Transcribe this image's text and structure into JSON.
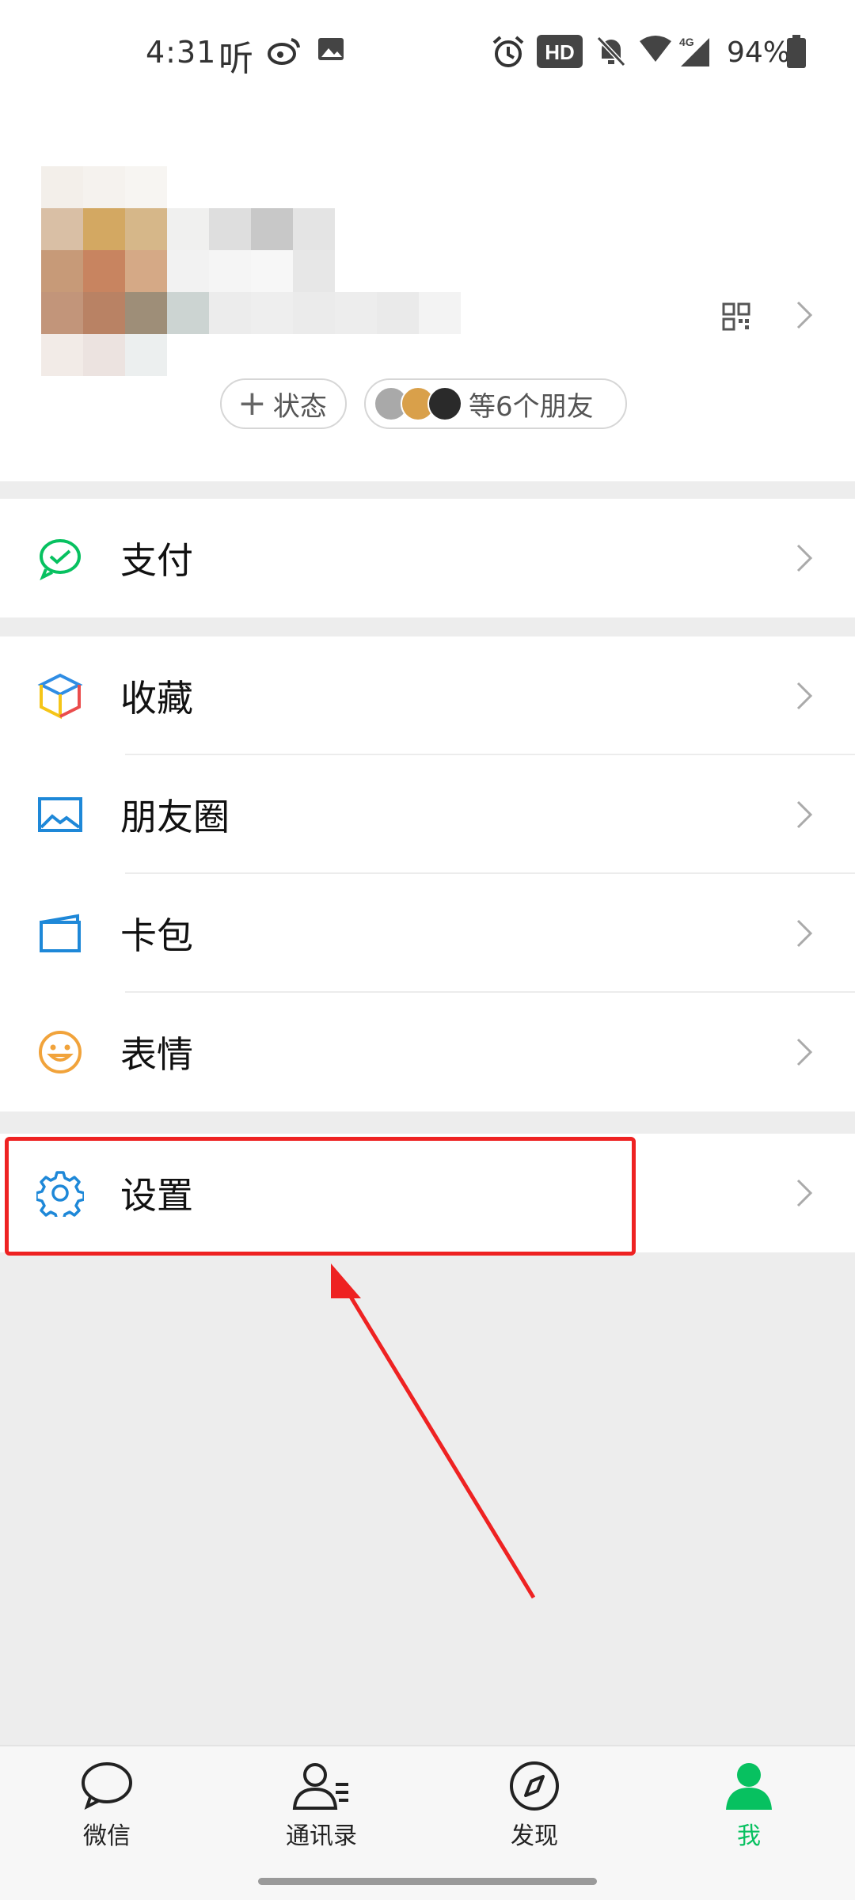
{
  "status_bar": {
    "time": "4:31",
    "listen_glyph": "听",
    "battery_percent": "94%",
    "network": "4G",
    "hd_badge": "HD",
    "icons": [
      "weibo-icon",
      "gallery-icon",
      "alarm-icon",
      "hd-icon",
      "mute-icon",
      "wifi-icon",
      "signal-icon",
      "battery-icon"
    ]
  },
  "profile": {
    "status_button": "状态",
    "friends_text": "等6个朋友",
    "qr_icon": "qr-code-icon"
  },
  "menu": {
    "pay": "支付",
    "favorites": "收藏",
    "moments": "朋友圈",
    "cards": "卡包",
    "stickers": "表情",
    "settings": "设置"
  },
  "bottom_nav": {
    "chats": "微信",
    "contacts": "通讯录",
    "discover": "发现",
    "me": "我",
    "active": "me"
  },
  "colors": {
    "brand_green": "#07c160",
    "highlight_red": "#ee2222",
    "icon_blue": "#1e88d8",
    "sticker_orange": "#f1a33b"
  }
}
